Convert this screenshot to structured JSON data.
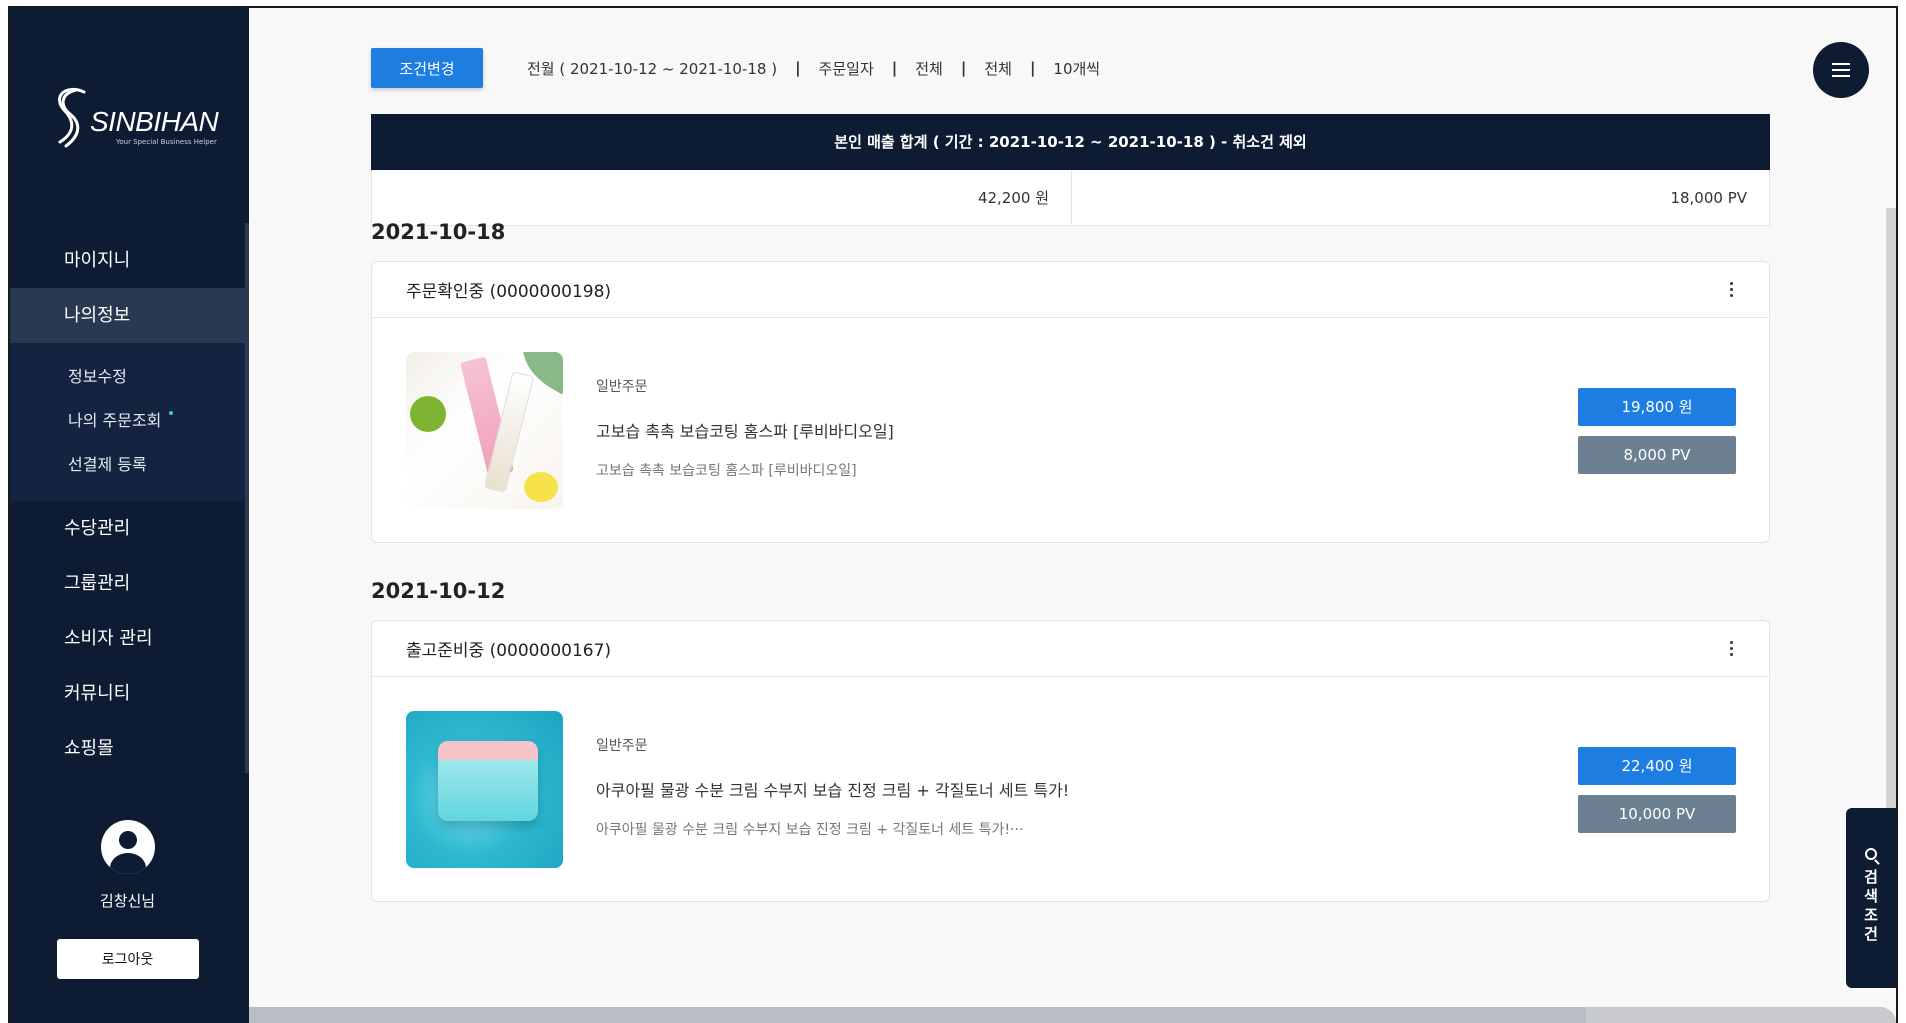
{
  "brand": {
    "name": "SINBIHAN",
    "tagline": "Your Special Business Helper"
  },
  "sidebar": {
    "items": [
      {
        "label": "마이지니"
      },
      {
        "label": "나의정보"
      },
      {
        "label": "수당관리"
      },
      {
        "label": "그룹관리"
      },
      {
        "label": "소비자 관리"
      },
      {
        "label": "커뮤니티"
      },
      {
        "label": "쇼핑몰"
      }
    ],
    "subitems": [
      {
        "label": "정보수정"
      },
      {
        "label": "나의 주문조회"
      },
      {
        "label": "선결제 등록"
      }
    ],
    "user": {
      "name": "김창신님"
    },
    "logout_label": "로그아웃"
  },
  "filter": {
    "button_label": "조건변경",
    "items": [
      "전월 ( 2021-10-12 ~ 2021-10-18 )",
      "주문일자",
      "전체",
      "전체",
      "10개씩"
    ],
    "separator": "|"
  },
  "summary": {
    "title": "본인 매출 합계 ( 기간 : 2021-10-12 ~ 2021-10-18 ) - 취소건 제외",
    "amount": "42,200 원",
    "pv": "18,000 PV"
  },
  "orders": [
    {
      "date": "2021-10-18",
      "status": "주문확인중 (0000000198)",
      "type": "일반주문",
      "name": "고보습 촉촉 보습코팅 홈스파 [루비바디오일]",
      "subname": "고보습 촉촉 보습코팅 홈스파 [루비바디오일]",
      "price": "19,800 원",
      "pv": "8,000 PV"
    },
    {
      "date": "2021-10-12",
      "status": "출고준비중 (0000000167)",
      "type": "일반주문",
      "name": "아쿠아필 물광 수분 크림 수부지 보습 진정 크림 + 각질토너 세트 특가!",
      "subname": "아쿠아필 물광 수분 크림 수부지 보습 진정 크림 + 각질토너 세트 특가!···",
      "price": "22,400 원",
      "pv": "10,000 PV"
    }
  ],
  "search_tab": {
    "label": [
      "검",
      "색",
      "조",
      "건"
    ]
  },
  "colors": {
    "navy": "#0d1b33",
    "blue": "#1e7de0",
    "gray_pv": "#6d8092"
  }
}
